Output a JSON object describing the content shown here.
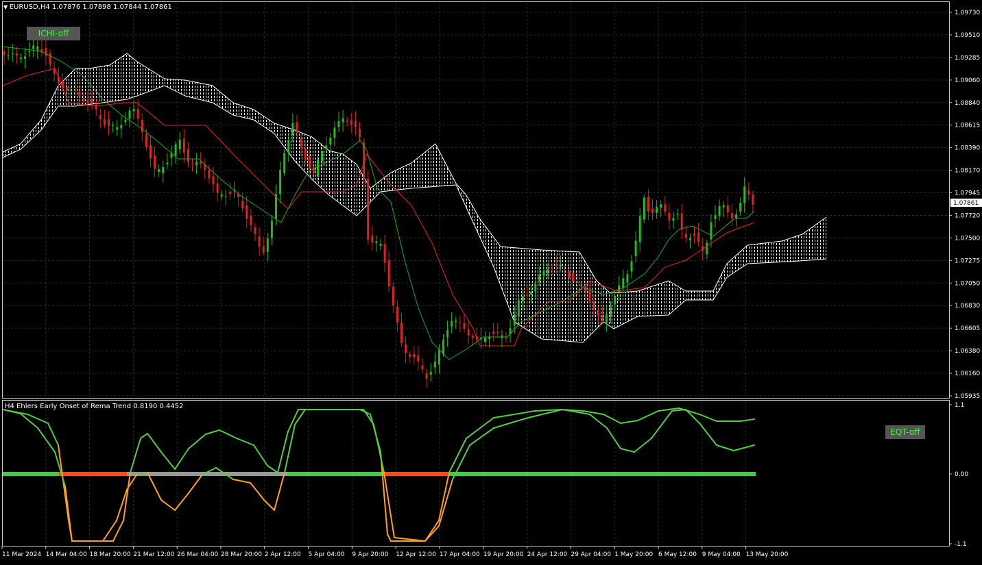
{
  "main": {
    "header": "EURUSD,H4  1.07876 1.07898 1.07844 1.07861",
    "ichi_button": "ICHI-off",
    "price_levels": [
      "1.09730",
      "1.09510",
      "1.09285",
      "1.09060",
      "1.08840",
      "1.08615",
      "1.08390",
      "1.08170",
      "1.07945",
      "1.07720",
      "1.07500",
      "1.07275",
      "1.07050",
      "1.06830",
      "1.06605",
      "1.06380",
      "1.06160",
      "1.05935"
    ],
    "current_price": "1.07861"
  },
  "indicator": {
    "header": "H4 Ehlers Early Onset of Rema Trend 0.8190 0.4452",
    "eqt_button": "EQT-off",
    "scale_labels": [
      "1.1",
      "0.00",
      "-1.1"
    ]
  },
  "time_axis": {
    "labels": [
      "11 Mar 2024",
      "14 Mar 04:00",
      "18 Mar 20:00",
      "21 Mar 12:00",
      "26 Mar 04:00",
      "28 Mar 20:00",
      "2 Apr 12:00",
      "5 Apr 04:00",
      "9 Apr 20:00",
      "12 Apr 12:00",
      "17 Apr 04:00",
      "19 Apr 20:00",
      "24 Apr 12:00",
      "29 Apr 04:00",
      "1 May 20:00",
      "6 May 12:00",
      "9 May 04:00",
      "13 May 20:00"
    ]
  },
  "colors": {
    "bull": "#22bb22",
    "bear": "#dd2222",
    "tenkan": "#22aa22",
    "kijun": "#ee2222",
    "cloud": "#ffffff",
    "eqt_line": "#55cc44",
    "eqt_bear": "#ffa020",
    "zero_bull": "#44cc44",
    "zero_bear": "#ff4a1c",
    "zero_neutral": "#999999"
  }
}
